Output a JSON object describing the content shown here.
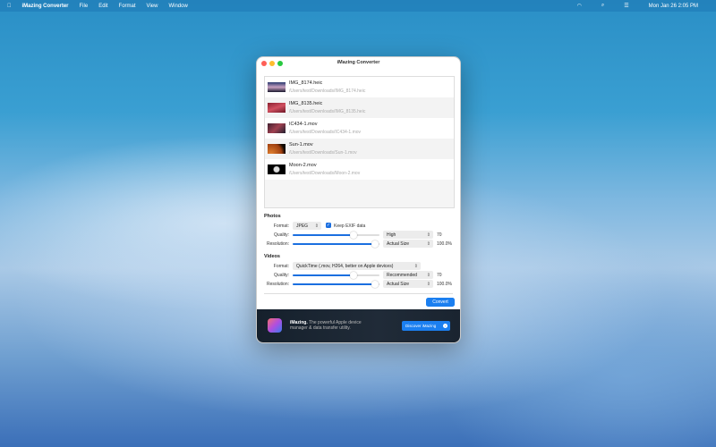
{
  "menubar": {
    "app": "iMazing Converter",
    "items": [
      "File",
      "Edit",
      "Format",
      "View",
      "Window"
    ],
    "clock": "Mon Jan 26  2:05 PM"
  },
  "window": {
    "title": "iMazing Converter"
  },
  "files": [
    {
      "name": "IMG_8174.heic",
      "path": "/Users/test/Downloads/IMG_8174.heic"
    },
    {
      "name": "IMG_8135.heic",
      "path": "/Users/test/Downloads/IMG_8135.heic"
    },
    {
      "name": "IC434-1.mov",
      "path": "/Users/test/Downloads/IC434-1.mov"
    },
    {
      "name": "Sun-1.mov",
      "path": "/Users/test/Downloads/Sun-1.mov"
    },
    {
      "name": "Moon-2.mov",
      "path": "/Users/test/Downloads/Moon-2.mov"
    }
  ],
  "photos": {
    "title": "Photos",
    "format_label": "Format:",
    "format": "JPEG",
    "exif_label": "Keep EXIF data",
    "exif_checked": true,
    "quality_label": "Quality:",
    "quality_preset": "High",
    "quality_value": "70",
    "quality_fraction": 0.7,
    "resolution_label": "Resolution:",
    "resolution_preset": "Actual Size",
    "resolution_value": "100.0%",
    "resolution_fraction": 1.0
  },
  "videos": {
    "title": "Videos",
    "format_label": "Format:",
    "format": "QuickTime (.mov, H264, better on Apple devices)",
    "quality_label": "Quality:",
    "quality_preset": "Recommended",
    "quality_value": "70",
    "quality_fraction": 0.7,
    "resolution_label": "Resolution:",
    "resolution_preset": "Actual Size",
    "resolution_value": "100.0%",
    "resolution_fraction": 1.0
  },
  "convert_label": "Convert",
  "footer": {
    "brand": "iMazing.",
    "text": " The powerful Apple device manager & data transfer utility.",
    "button": "Discover iMazing"
  }
}
